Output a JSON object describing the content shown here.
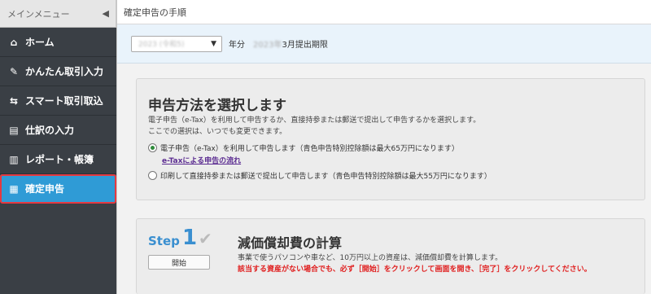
{
  "sidebar": {
    "title": "メインメニュー",
    "collapse_icon": "chevron-left-icon",
    "items": [
      {
        "label": "ホーム",
        "icon": "home-icon"
      },
      {
        "label": "かんたん取引入力",
        "icon": "pencil-icon"
      },
      {
        "label": "スマート取引取込",
        "icon": "import-icon"
      },
      {
        "label": "仕訳の入力",
        "icon": "journal-icon"
      },
      {
        "label": "レポート・帳簿",
        "icon": "report-icon"
      },
      {
        "label": "確定申告",
        "icon": "tax-return-icon",
        "active": true
      }
    ]
  },
  "header": {
    "title": "確定申告の手順"
  },
  "filter": {
    "year_select_value": "2023 (令和5)",
    "after_select": "年分",
    "deadline_blurred": "2023年",
    "deadline_label": "3月提出期限"
  },
  "method_card": {
    "title": "申告方法を選択します",
    "desc_line1": "電子申告（e-Tax）を利用して申告するか、直接持参または郵送で提出して申告するかを選択します。",
    "desc_line2": "ここでの選択は、いつでも変更できます。",
    "option_etax": "電子申告（e-Tax）を利用して申告します（青色申告特別控除額は最大65万円になります）",
    "etax_link": "e-Taxによる申告の流れ",
    "option_paper": "印刷して直接持参または郵送で提出して申告します（青色申告特別控除額は最大55万円になります）"
  },
  "step_card": {
    "step_label": "Step",
    "step_number": "1",
    "start_button": "開始",
    "title": "減価償却費の計算",
    "desc": "事業で使うパソコンや車など、10万円以上の資産は、減価償却費を計算します。",
    "warning": "該当する資産がない場合でも、必ず［開始］をクリックして画面を開き、［完了］をクリックしてください。"
  },
  "colors": {
    "sidebar_bg": "#3a3f45",
    "active_bg": "#2f9bd6",
    "highlight_border": "#e53940",
    "step_blue": "#3a8fd0",
    "warning_red": "#e02020",
    "link_purple": "#5b2c91"
  }
}
